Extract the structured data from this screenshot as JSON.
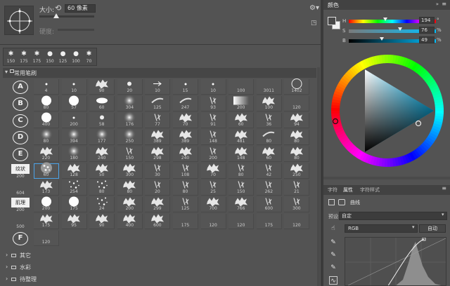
{
  "toolbar": {
    "size_label": "大小:",
    "size_value": "60 像素",
    "hardness_label": "硬度:"
  },
  "recent_brushes": [
    {
      "glyph": "✱",
      "size": "150"
    },
    {
      "glyph": "✱",
      "size": "175"
    },
    {
      "glyph": "✱",
      "size": "175"
    },
    {
      "glyph": "●",
      "size": "150"
    },
    {
      "glyph": "●",
      "size": "125"
    },
    {
      "glyph": "●",
      "size": "100"
    },
    {
      "glyph": "✱",
      "size": "70"
    }
  ],
  "group": {
    "name": "常用笔刷"
  },
  "rows": [
    {
      "label": "A",
      "kind": "circle",
      "cells": [
        {
          "s": "dot",
          "n": "4"
        },
        {
          "s": "dot",
          "n": "10"
        },
        {
          "s": "splat",
          "n": "90"
        },
        {
          "s": "small",
          "n": "20"
        },
        {
          "s": "arrow",
          "n": "10"
        },
        {
          "s": "dot",
          "n": "15"
        },
        {
          "s": "dot",
          "n": "10"
        },
        {
          "s": "none",
          "n": "100"
        },
        {
          "s": "none",
          "n": "3011"
        },
        {
          "s": "ring",
          "n": "1402"
        }
      ]
    },
    {
      "label": "B",
      "kind": "circle",
      "cells": [
        {
          "s": "hard",
          "n": "80"
        },
        {
          "s": "hard",
          "n": "57"
        },
        {
          "s": "oval",
          "n": "60"
        },
        {
          "s": "soft",
          "n": "304"
        },
        {
          "s": "streak",
          "n": "125"
        },
        {
          "s": "streak",
          "n": "247"
        },
        {
          "s": "mark",
          "n": "93"
        },
        {
          "s": "grad",
          "n": "200"
        },
        {
          "s": "splat",
          "n": "100"
        },
        {
          "s": "none",
          "n": "120"
        }
      ]
    },
    {
      "label": "C",
      "kind": "circle",
      "cells": [
        {
          "s": "hard",
          "n": "400"
        },
        {
          "s": "dot",
          "n": "200"
        },
        {
          "s": "small",
          "n": "58"
        },
        {
          "s": "soft",
          "n": "176"
        },
        {
          "s": "mark",
          "n": "77"
        },
        {
          "s": "splat",
          "n": "70"
        },
        {
          "s": "mark",
          "n": "91"
        },
        {
          "s": "splat",
          "n": "60"
        },
        {
          "s": "mark",
          "n": "36"
        },
        {
          "s": "splat",
          "n": "94"
        }
      ]
    },
    {
      "label": "D",
      "kind": "circle",
      "cells": [
        {
          "s": "soft",
          "n": "80"
        },
        {
          "s": "soft",
          "n": "394"
        },
        {
          "s": "soft",
          "n": "177"
        },
        {
          "s": "soft",
          "n": "250"
        },
        {
          "s": "splat",
          "n": "389"
        },
        {
          "s": "splat",
          "n": "389"
        },
        {
          "s": "mark",
          "n": "148"
        },
        {
          "s": "splat",
          "n": "481"
        },
        {
          "s": "streak",
          "n": "80"
        },
        {
          "s": "splat",
          "n": "80"
        }
      ]
    },
    {
      "label": "E",
      "kind": "circle",
      "cells": [
        {
          "s": "splat",
          "n": "220"
        },
        {
          "s": "soft",
          "n": "180"
        },
        {
          "s": "splat",
          "n": "240"
        },
        {
          "s": "mark",
          "n": "150"
        },
        {
          "s": "splat",
          "n": "298"
        },
        {
          "s": "splat",
          "n": "240"
        },
        {
          "s": "mark",
          "n": "200"
        },
        {
          "s": "splat",
          "n": "148"
        },
        {
          "s": "splat",
          "n": "60"
        },
        {
          "s": "splat",
          "n": "80"
        }
      ]
    },
    {
      "label": "纹状",
      "kind": "tag",
      "tagnum": "200",
      "cells": [
        {
          "s": "texture",
          "n": "60",
          "sel": true
        },
        {
          "s": "splat",
          "n": "128"
        },
        {
          "s": "splat",
          "n": "50"
        },
        {
          "s": "splat",
          "n": "300"
        },
        {
          "s": "mark",
          "n": "30"
        },
        {
          "s": "mark",
          "n": "108"
        },
        {
          "s": "splat",
          "n": "70"
        },
        {
          "s": "mark",
          "n": "80"
        },
        {
          "s": "mark",
          "n": "42"
        },
        {
          "s": "splat",
          "n": "250"
        }
      ]
    },
    {
      "label": "",
      "kind": "num",
      "tagnum": "604",
      "cells": [
        {
          "s": "splat",
          "n": "173"
        },
        {
          "s": "dots",
          "n": "254"
        },
        {
          "s": "dots",
          "n": "80"
        },
        {
          "s": "splat",
          "n": "80"
        },
        {
          "s": "mark",
          "n": "20"
        },
        {
          "s": "mark",
          "n": "80"
        },
        {
          "s": "mark",
          "n": "25"
        },
        {
          "s": "mark",
          "n": "150"
        },
        {
          "s": "mark",
          "n": "262"
        },
        {
          "s": "mark",
          "n": "21"
        }
      ]
    },
    {
      "label": "肌理",
      "kind": "tag",
      "tagnum": "200",
      "cells": [
        {
          "s": "hard",
          "n": "200"
        },
        {
          "s": "hard",
          "n": "175"
        },
        {
          "s": "dots",
          "n": "24"
        },
        {
          "s": "splat",
          "n": "200"
        },
        {
          "s": "splat",
          "n": "299"
        },
        {
          "s": "mark",
          "n": "125"
        },
        {
          "s": "splat",
          "n": "700"
        },
        {
          "s": "splat",
          "n": "766"
        },
        {
          "s": "mark",
          "n": "600"
        },
        {
          "s": "mark",
          "n": "300"
        }
      ]
    },
    {
      "label": "",
      "kind": "num",
      "tagnum": "500",
      "cells": [
        {
          "s": "splat",
          "n": "175"
        },
        {
          "s": "splat",
          "n": "95"
        },
        {
          "s": "splat",
          "n": "90"
        },
        {
          "s": "splat",
          "n": "400"
        },
        {
          "s": "splat",
          "n": "600"
        },
        {
          "s": "none",
          "n": "175"
        },
        {
          "s": "none",
          "n": "120"
        },
        {
          "s": "none",
          "n": "120"
        },
        {
          "s": "none",
          "n": "175"
        },
        {
          "s": "none",
          "n": "120"
        }
      ]
    },
    {
      "label": "F",
      "kind": "circle",
      "cells": [
        {
          "s": "none",
          "n": "120"
        }
      ]
    }
  ],
  "folders": [
    "其它",
    "水彩",
    "待整理"
  ],
  "color_panel": {
    "title": "颜色",
    "h_label": "H",
    "h_value": "194",
    "h_unit": "°",
    "s_label": "S",
    "s_value": "76",
    "s_unit": "%",
    "b_label": "B",
    "b_value": "49",
    "b_unit": "%",
    "hue_fraction": 0.54,
    "sat_fraction": 0.76,
    "bri_fraction": 0.49,
    "triangle_hue": "#00bfff"
  },
  "props_panel": {
    "tabs": [
      "字符",
      "属性",
      "字符样式"
    ],
    "active_tab": "属性",
    "title": "曲线",
    "preset_label": "预设:",
    "preset_value": "自定",
    "channel_value": "RGB",
    "auto_label": "自动"
  }
}
